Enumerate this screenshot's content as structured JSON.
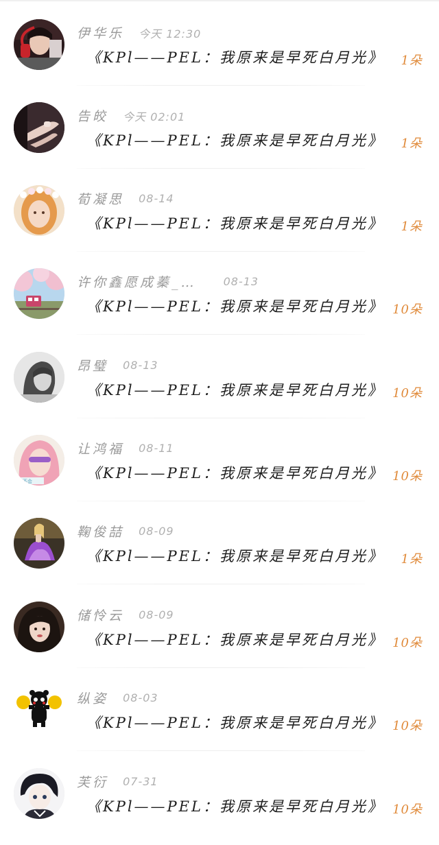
{
  "flower_gifts": [
    {
      "name": "伊华乐",
      "date": "今天 12:30",
      "title": "《KPl——PEL：我原来是早死白月光》",
      "count": "1朵",
      "avatar": "avatar-man-red-headphones"
    },
    {
      "name": "告皎",
      "date": "今天 02:01",
      "title": "《KPl——PEL：我原来是早死白月光》",
      "count": "1朵",
      "avatar": "avatar-hands"
    },
    {
      "name": "荀凝思",
      "date": "08-14",
      "title": "《KPl——PEL：我原来是早死白月光》",
      "count": "1朵",
      "avatar": "avatar-girl-flower-crown"
    },
    {
      "name": "许你鑫愿成蓁_…",
      "date": "08-13",
      "title": "《KPl——PEL：我原来是早死白月光》",
      "count": "10朵",
      "avatar": "avatar-cherry-blossom-train"
    },
    {
      "name": "昂璧",
      "date": "08-13",
      "title": "《KPl——PEL：我原来是早死白月光》",
      "count": "10朵",
      "avatar": "avatar-grayscale-girl"
    },
    {
      "name": "让鸿福",
      "date": "08-11",
      "title": "《KPl——PEL：我原来是早死白月光》",
      "count": "10朵",
      "avatar": "avatar-pink-hair-girl"
    },
    {
      "name": "鞠俊喆",
      "date": "08-09",
      "title": "《KPl——PEL：我原来是早死白月光》",
      "count": "1朵",
      "avatar": "avatar-purple-dress"
    },
    {
      "name": "储怜云",
      "date": "08-09",
      "title": "《KPl——PEL：我原来是早死白月光》",
      "count": "10朵",
      "avatar": "avatar-dark-hair-girl"
    },
    {
      "name": "纵姿",
      "date": "08-03",
      "title": "《KPl——PEL：我原来是早死白月光》",
      "count": "10朵",
      "avatar": "avatar-kumamon-cheer"
    },
    {
      "name": "芙衍",
      "date": "07-31",
      "title": "《KPl——PEL：我原来是早死白月光》",
      "count": "10朵",
      "avatar": "avatar-anime-boy"
    }
  ],
  "colors": {
    "accent_count": "#e08a3a",
    "name_text": "#9a9a9a",
    "date_text": "#b0b0b0",
    "title_text": "#1e1e1e"
  }
}
